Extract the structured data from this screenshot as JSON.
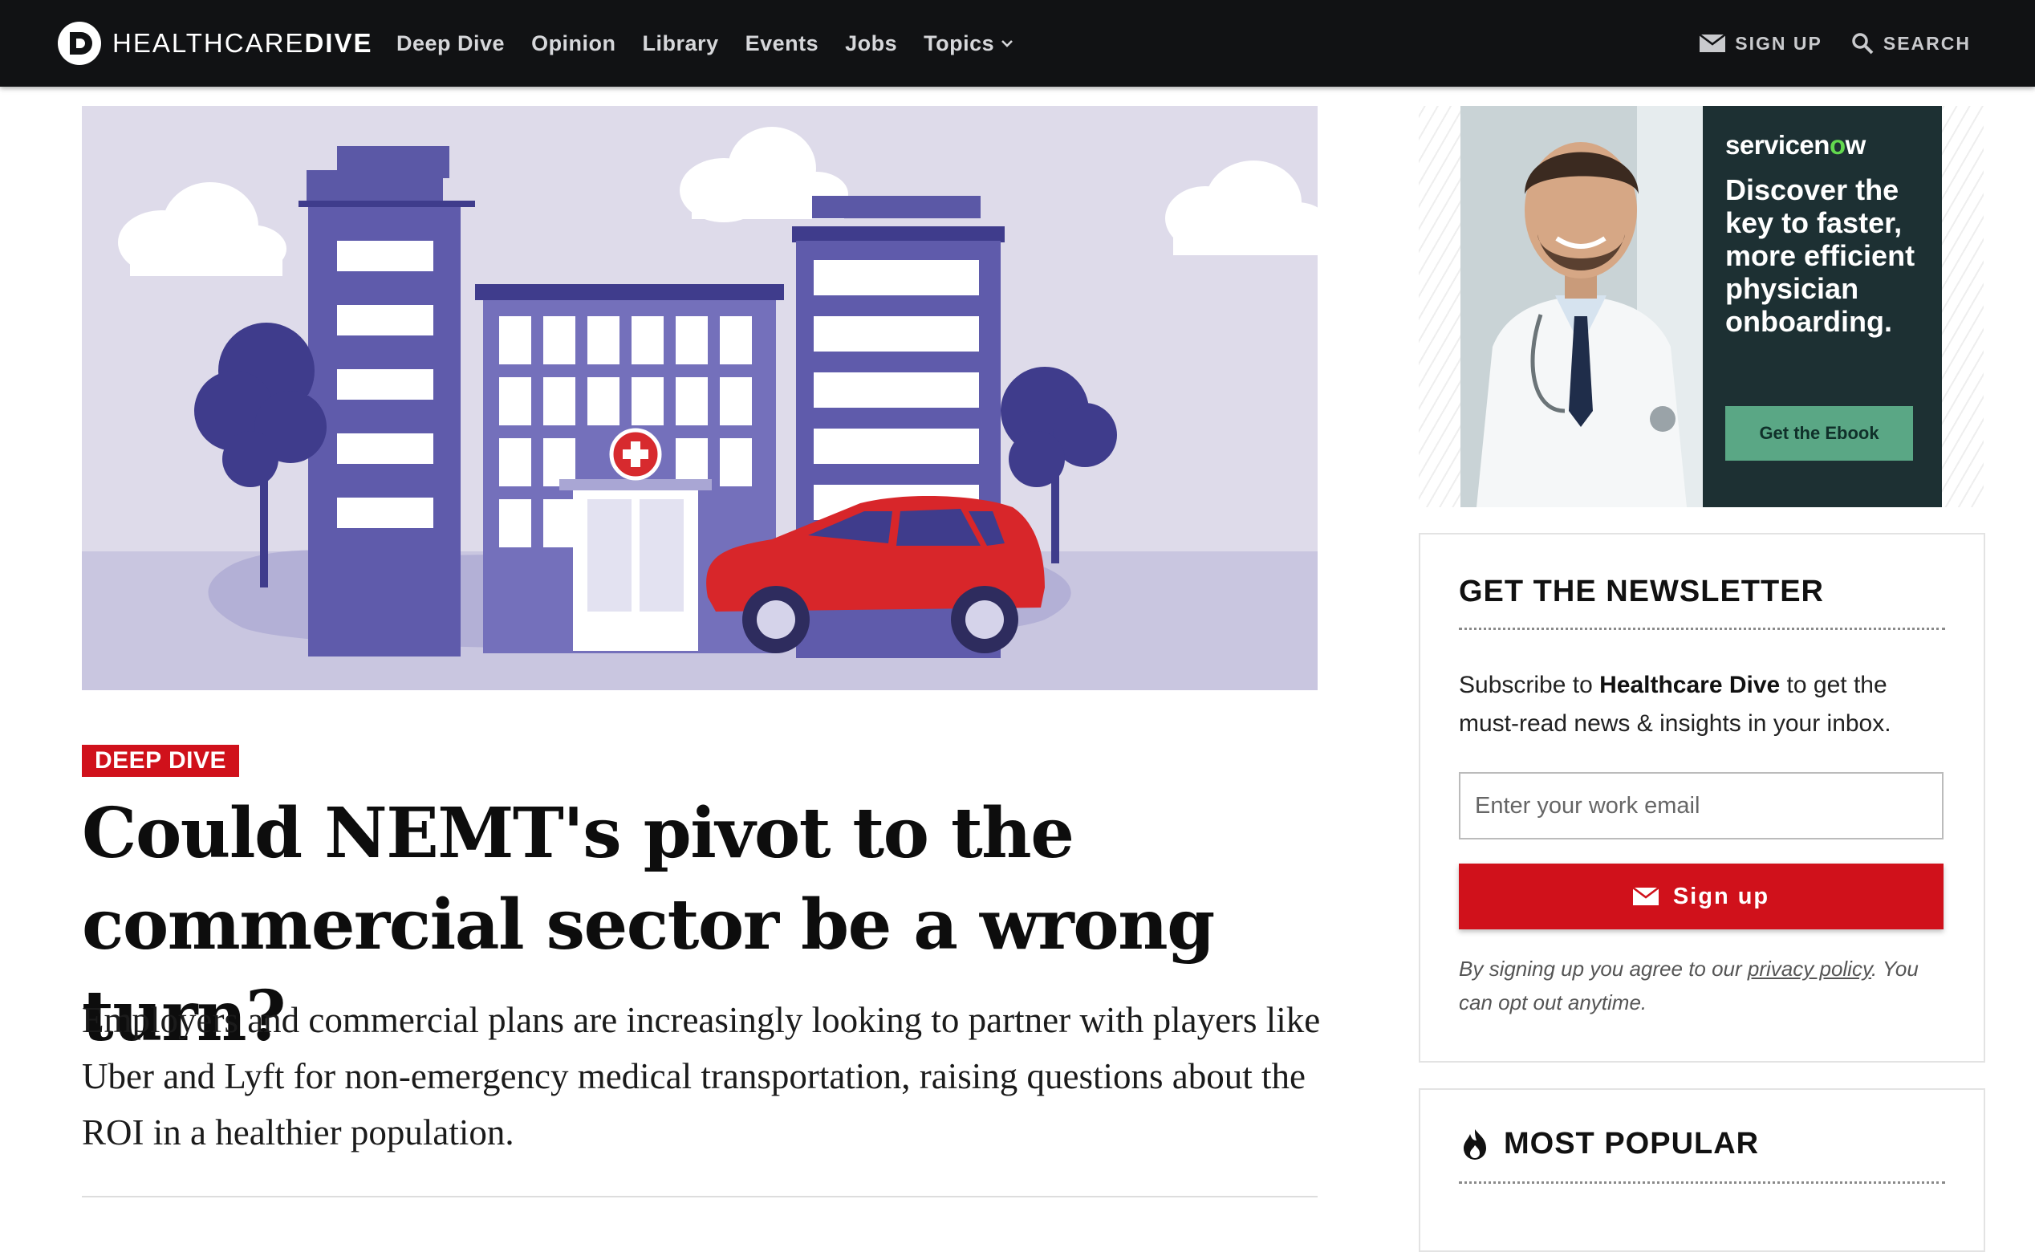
{
  "nav": {
    "logo_light": "HEALTHCARE",
    "logo_bold": "DIVE",
    "links": [
      "Deep Dive",
      "Opinion",
      "Library",
      "Events",
      "Jobs",
      "Topics"
    ],
    "sign_up": "SIGN UP",
    "search": "SEARCH"
  },
  "article": {
    "tag": "DEEP DIVE",
    "headline": "Could NEMT's pivot to the commercial sector be a wrong turn?",
    "dek": "Employers and commercial plans are increasingly looking to partner with players like Uber and Lyft for non-emergency medical transportation, raising questions about the ROI in a healthier population."
  },
  "ad": {
    "brand_pre": "servicen",
    "brand_o": "o",
    "brand_post": "w",
    "copy": "Discover the key to faster, more efficient physician onboarding.",
    "cta": "Get the Ebook"
  },
  "newsletter": {
    "title": "GET THE NEWSLETTER",
    "text_pre": "Subscribe to ",
    "text_brand": "Healthcare Dive",
    "text_post": " to get the must-read news & insights in your inbox.",
    "placeholder": "Enter your work email",
    "button": "Sign up",
    "fine_pre": "By signing up you agree to our ",
    "fine_link": "privacy policy",
    "fine_post": ". You can opt out anytime."
  },
  "most_popular": {
    "title": "MOST POPULAR"
  },
  "colors": {
    "brand_red": "#d0111b",
    "nav_bg": "#111214",
    "ad_bg": "#1d3033",
    "ad_button": "#5aa785"
  }
}
